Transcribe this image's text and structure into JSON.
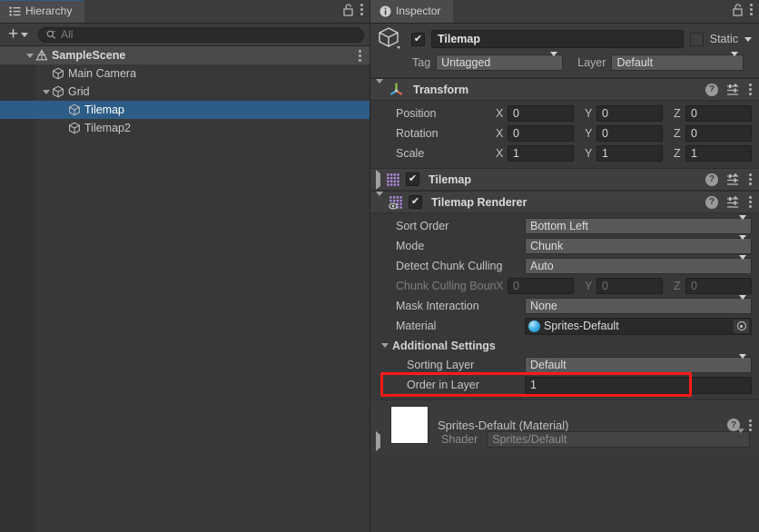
{
  "hierarchy": {
    "tab_label": "Hierarchy",
    "tab_icon": "hierarchy-icon",
    "lock_icon": "unlock-icon",
    "menu_icon": "kebab-menu-icon",
    "toolbar": {
      "add_label": "+",
      "search_placeholder": "All",
      "search_value": "",
      "search_icon": "search-icon"
    },
    "tree": [
      {
        "label": "SampleScene",
        "depth": 0,
        "icon": "unity-scene-icon",
        "expanded": true,
        "selected": false,
        "has_menu": true
      },
      {
        "label": "Main Camera",
        "depth": 1,
        "icon": "gameobject-cube-icon",
        "expanded": null,
        "selected": false,
        "has_menu": false
      },
      {
        "label": "Grid",
        "depth": 1,
        "icon": "gameobject-cube-icon",
        "expanded": true,
        "selected": false,
        "has_menu": false
      },
      {
        "label": "Tilemap",
        "depth": 2,
        "icon": "gameobject-cube-icon",
        "expanded": null,
        "selected": true,
        "has_menu": false
      },
      {
        "label": "Tilemap2",
        "depth": 2,
        "icon": "gameobject-cube-icon",
        "expanded": null,
        "selected": false,
        "has_menu": false
      }
    ]
  },
  "inspector": {
    "tab_label": "Inspector",
    "tab_icon": "info-icon",
    "lock_icon": "unlock-icon",
    "menu_icon": "kebab-menu-icon",
    "gameobject": {
      "icon": "gameobject-cube-icon",
      "enabled": true,
      "name": "Tilemap",
      "static_label": "Static",
      "static_checked": false,
      "tag_label": "Tag",
      "tag_value": "Untagged",
      "layer_label": "Layer",
      "layer_value": "Default"
    },
    "components": [
      {
        "title": "Transform",
        "icon": "transform-axis-icon",
        "expanded": true,
        "has_checkbox": false,
        "rows": [
          {
            "label": "Position",
            "type": "vector3",
            "x": "0",
            "y": "0",
            "z": "0",
            "disabled": false
          },
          {
            "label": "Rotation",
            "type": "vector3",
            "x": "0",
            "y": "0",
            "z": "0",
            "disabled": false
          },
          {
            "label": "Scale",
            "type": "vector3",
            "x": "1",
            "y": "1",
            "z": "1",
            "disabled": false
          }
        ]
      },
      {
        "title": "Tilemap",
        "icon": "tilemap-grid-icon",
        "expanded": false,
        "has_checkbox": true,
        "enabled": true,
        "rows": []
      },
      {
        "title": "Tilemap Renderer",
        "icon": "tilemap-renderer-icon",
        "expanded": true,
        "has_checkbox": true,
        "enabled": true,
        "rows": [
          {
            "label": "Sort Order",
            "type": "dropdown",
            "value": "Bottom Left",
            "disabled": false
          },
          {
            "label": "Mode",
            "type": "dropdown",
            "value": "Chunk",
            "disabled": false
          },
          {
            "label": "Detect Chunk Culling",
            "type": "dropdown",
            "value": "Auto",
            "disabled": false
          },
          {
            "label": "Chunk Culling Bounds",
            "type": "vector3",
            "x": "0",
            "y": "0",
            "z": "0",
            "disabled": true
          },
          {
            "label": "Mask Interaction",
            "type": "dropdown",
            "value": "None",
            "disabled": false
          },
          {
            "label": "Material",
            "type": "object",
            "value": "Sprites-Default",
            "icon": "material-sphere-icon",
            "picker_icon": "object-picker-icon",
            "disabled": false
          }
        ],
        "additional_settings": {
          "label": "Additional Settings",
          "expanded": true,
          "rows": [
            {
              "label": "Sorting Layer",
              "type": "dropdown",
              "value": "Default",
              "disabled": false
            },
            {
              "label": "Order in Layer",
              "type": "number",
              "value": "1",
              "disabled": false,
              "highlighted": true
            }
          ]
        }
      }
    ],
    "material_preview": {
      "title": "Sprites-Default (Material)",
      "swatch_color": "#ffffff",
      "help_icon": "help-icon",
      "menu_icon": "kebab-menu-icon",
      "shader_label": "Shader",
      "shader_value": "Sprites/Default",
      "expanded": false
    },
    "header_icons": {
      "help": "help-icon",
      "preset": "preset-sliders-icon",
      "menu": "kebab-menu-icon"
    }
  },
  "annotation": {
    "highlight_color": "#ff1a1a",
    "target": "Order in Layer"
  }
}
